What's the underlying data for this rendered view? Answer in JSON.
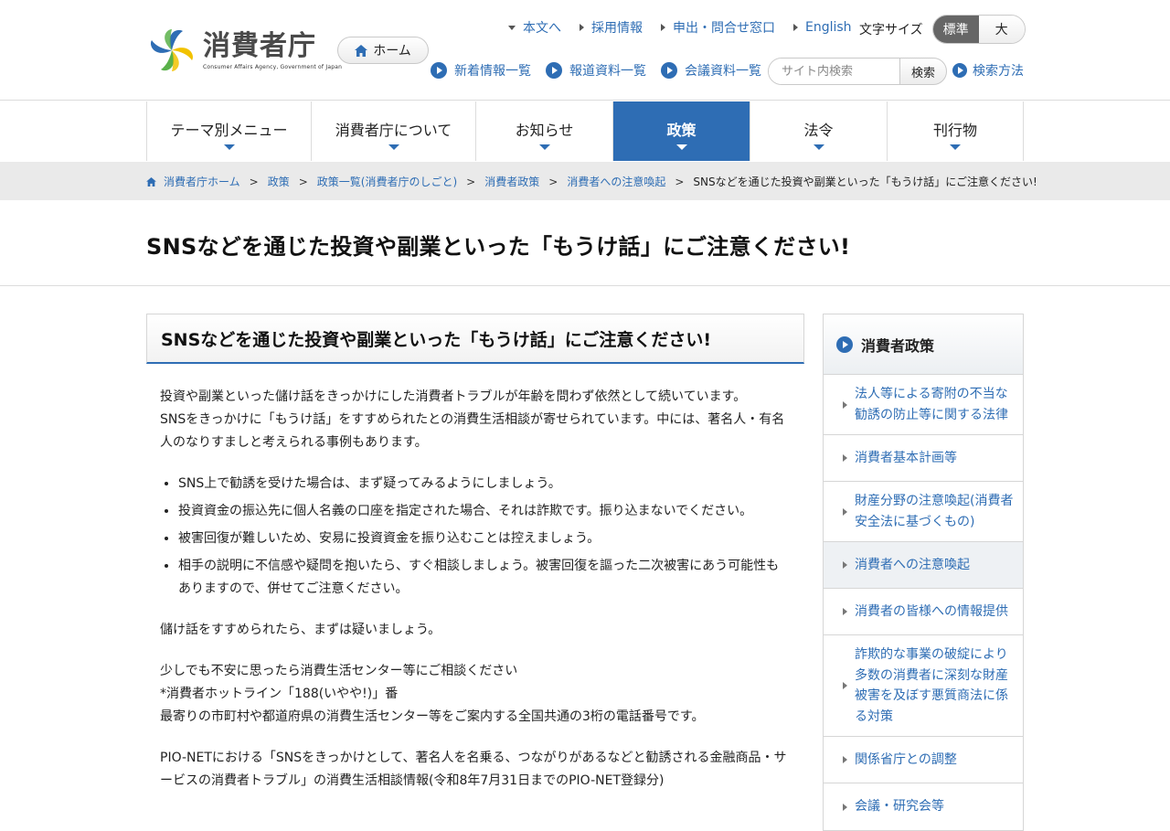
{
  "header": {
    "logo_title": "消費者庁",
    "logo_subtitle": "Consumer Affairs Agency, Government of Japan",
    "home_label": "ホーム",
    "util_links": [
      "本文へ",
      "採用情報",
      "申出・問合せ窓口",
      "English"
    ],
    "fontsize_label": "文字サイズ",
    "fontsize_standard": "標準",
    "fontsize_large": "大",
    "sub_links": [
      "新着情報一覧",
      "報道資料一覧",
      "会議資料一覧"
    ],
    "search_placeholder": "サイト内検索",
    "search_button": "検索",
    "search_help": "検索方法"
  },
  "nav": [
    {
      "label": "テーマ別メニュー"
    },
    {
      "label": "消費者庁について"
    },
    {
      "label": "お知らせ"
    },
    {
      "label": "政策"
    },
    {
      "label": "法令"
    },
    {
      "label": "刊行物"
    }
  ],
  "breadcrumb": [
    "消費者庁ホーム",
    "政策",
    "政策一覧(消費者庁のしごと)",
    "消費者政策",
    "消費者への注意喚起",
    "SNSなどを通じた投資や副業といった「もうけ話」にご注意ください!"
  ],
  "page": {
    "title": "SNSなどを通じた投資や副業といった「もうけ話」にご注意ください!",
    "heading": "SNSなどを通じた投資や副業といった「もうけ話」にご注意ください!",
    "intro": [
      "投資や副業といった儲け話をきっかけにした消費者トラブルが年齢を問わず依然として続いています。",
      "SNSをきっかけに「もうけ話」をすすめられたとの消費生活相談が寄せられています。中には、著名人・有名人のなりすましと考えられる事例もあります。"
    ],
    "bullets": [
      "SNS上で勧誘を受けた場合は、まず疑ってみるようにしましょう。",
      "投資資金の振込先に個人名義の口座を指定された場合、それは詐欺です。振り込まないでください。",
      "被害回復が難しいため、安易に投資資金を振り込むことは控えましょう。",
      "相手の説明に不信感や疑問を抱いたら、すぐ相談しましょう。被害回復を謳った二次被害にあう可能性もありますので、併せてご注意ください。"
    ],
    "para_doubt": "儲け話をすすめられたら、まずは疑いましょう。",
    "consult": [
      "少しでも不安に思ったら消費生活センター等にご相談ください",
      "*消費者ホットライン「188(いやや!)」番",
      "最寄りの市町村や都道府県の消費生活センター等をご案内する全国共通の3桁の電話番号です。"
    ],
    "pionet": "PIO-NETにおける「SNSをきっかけとして、著名人を名乗る、つながりがあるなどと勧誘される金融商品・サービスの消費者トラブル」の消費生活相談情報(令和8年7月31日までのPIO-NET登録分)"
  },
  "sidebar": {
    "title": "消費者政策",
    "items": [
      "法人等による寄附の不当な勧誘の防止等に関する法律",
      "消費者基本計画等",
      "財産分野の注意喚起(消費者安全法に基づくもの)",
      "消費者への注意喚起",
      "消費者の皆様への情報提供",
      "詐欺的な事業の破綻により多数の消費者に深刻な財産被害を及ぼす悪質商法に係る対策",
      "関係省庁との調整",
      "会議・研究会等"
    ]
  },
  "colors": {
    "accent": "#2e6db4",
    "breadcrumb_bg": "#eaeaea",
    "logo_blue": "#2e6db4",
    "logo_green": "#5ab14a",
    "logo_yellow": "#f2c200"
  }
}
